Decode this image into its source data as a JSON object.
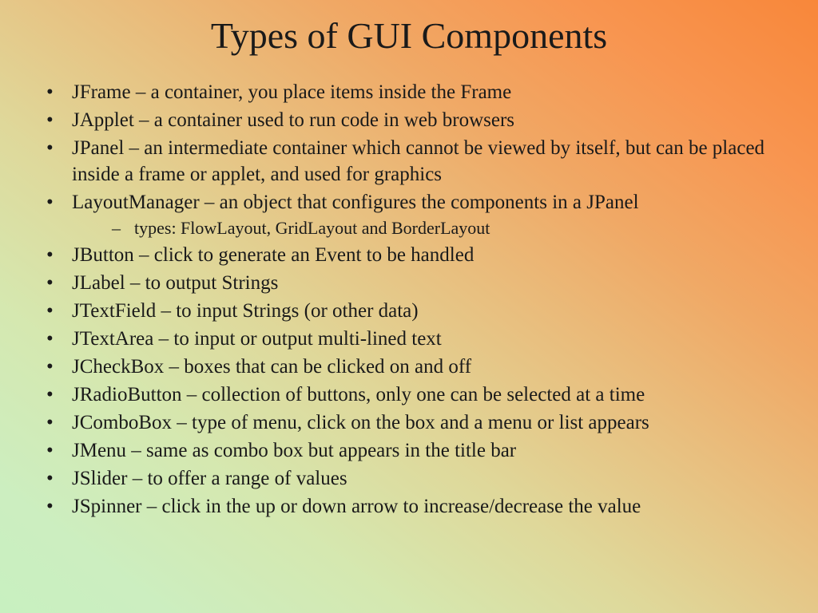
{
  "title": "Types of GUI Components",
  "bullets": {
    "b0": "JFrame – a container, you place items inside the Frame",
    "b1": "JApplet – a container used to run code in web browsers",
    "b2": "JPanel – an intermediate container which cannot be viewed by itself, but can be placed inside a frame or applet, and used for graphics",
    "b3": "LayoutManager – an object that configures the components in a JPanel",
    "b3sub0": "types:  FlowLayout, GridLayout and BorderLayout",
    "b4": "JButton – click to generate an Event to be handled",
    "b5": "JLabel – to output Strings",
    "b6": "JTextField – to input Strings (or other data)",
    "b7": "JTextArea – to input or output multi-lined text",
    "b8": "JCheckBox – boxes that can be clicked on and off",
    "b9": "JRadioButton – collection of buttons, only one can be selected at a time",
    "b10": "JComboBox – type of menu, click on the box and a menu or list appears",
    "b11": "JMenu – same as combo box but appears in the title bar",
    "b12": "JSlider – to offer a range of values",
    "b13": "JSpinner – click in the up or down arrow to increase/decrease the value"
  }
}
